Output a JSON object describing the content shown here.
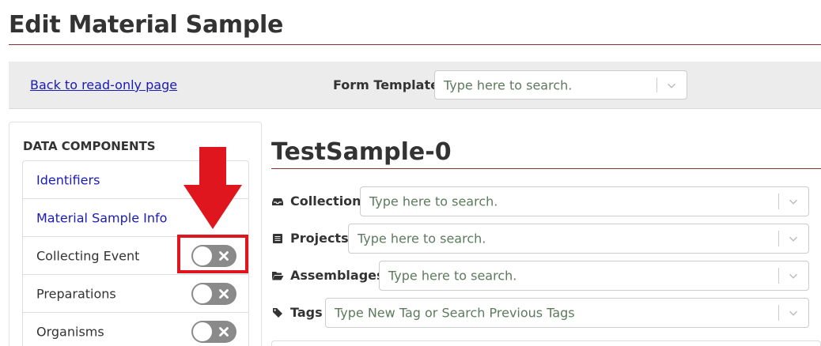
{
  "page": {
    "title": "Edit Material Sample"
  },
  "toolbar": {
    "back_link": "Back to read-only page",
    "form_template_label": "Form Template",
    "form_template_placeholder": "Type here to search."
  },
  "sidebar": {
    "heading": "DATA COMPONENTS",
    "items": [
      {
        "label": "Identifiers",
        "type": "link"
      },
      {
        "label": "Material Sample Info",
        "type": "link"
      },
      {
        "label": "Collecting Event",
        "type": "toggle",
        "enabled": false
      },
      {
        "label": "Preparations",
        "type": "toggle",
        "enabled": false
      },
      {
        "label": "Organisms",
        "type": "toggle",
        "enabled": false
      }
    ]
  },
  "record": {
    "title": "TestSample-0",
    "fields": [
      {
        "label": "Collection",
        "icon": "inbox-icon",
        "placeholder": "Type here to search."
      },
      {
        "label": "Projects",
        "icon": "list-icon",
        "placeholder": "Type here to search."
      },
      {
        "label": "Assemblages",
        "icon": "folder-open-icon",
        "placeholder": "Type here to search."
      },
      {
        "label": "Tags",
        "icon": "tags-icon",
        "placeholder": "Type New Tag or Search Previous Tags"
      }
    ]
  },
  "colors": {
    "accent_rule": "#8b2f2f",
    "link": "#1a1ab8",
    "placeholder": "#5c7a5c",
    "annotation_red": "#e0161e",
    "toggle_off": "#8a8a8a"
  }
}
